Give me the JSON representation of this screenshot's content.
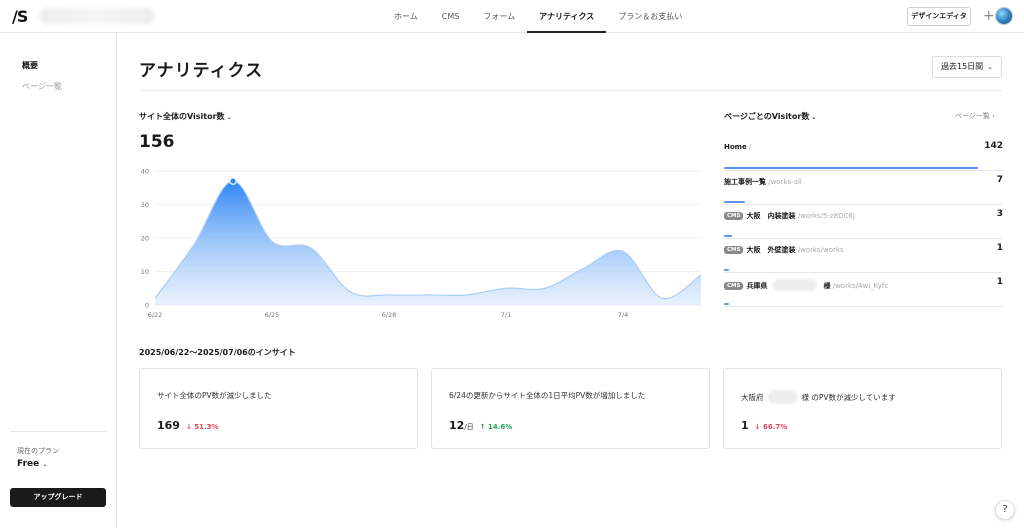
{
  "header": {
    "logo": "/S",
    "nav": [
      "ホーム",
      "CMS",
      "フォーム",
      "アナリティクス",
      "プラン＆お支払い"
    ],
    "active_nav": 3,
    "design_editor": "デザインエディタ",
    "plus": "+"
  },
  "sidebar": {
    "items": [
      "概要",
      "ページ一覧"
    ],
    "plan_label": "現在のプラン",
    "plan_value": "Free",
    "upgrade_label": "アップグレード"
  },
  "main": {
    "title": "アナリティクス",
    "period": "過去15日間"
  },
  "visitors": {
    "title": "サイト全体のVisitor数",
    "total": "156"
  },
  "chart_data": {
    "type": "area",
    "x": [
      "6/22",
      "6/23",
      "6/24",
      "6/25",
      "6/26",
      "6/27",
      "6/28",
      "6/29",
      "6/30",
      "7/1",
      "7/2",
      "7/3",
      "7/4",
      "7/5",
      "7/6"
    ],
    "series": [
      {
        "values": [
          2,
          18,
          37,
          19,
          17,
          4,
          3,
          3,
          3,
          5,
          5,
          11,
          16,
          2,
          9
        ]
      }
    ],
    "x_tick_labels": [
      "6/22",
      "6/25",
      "6/28",
      "7/1",
      "7/4"
    ],
    "y_ticks": [
      0,
      10,
      20,
      30,
      40
    ],
    "ylim": [
      0,
      40
    ],
    "grid": true,
    "highlight_index": 2,
    "color": "#2f86f5"
  },
  "page_visitors": {
    "title": "ページごとのVisitor数",
    "link": "ページ一覧",
    "rows": [
      {
        "name": "Home",
        "path": " /",
        "count": "142",
        "cms": false,
        "ratio": 1.0
      },
      {
        "name": "施工事例一覧",
        "path": " /works-all",
        "count": "7",
        "cms": false,
        "ratio": 0.05
      },
      {
        "name": "大阪　内装塗装",
        "path": " /works/5-z8DC6J",
        "count": "3",
        "cms": true,
        "ratio": 0.02
      },
      {
        "name": "大阪　外壁塗装",
        "path": " /works/works",
        "count": "1",
        "cms": true,
        "ratio": 0.008
      },
      {
        "name": "兵庫県",
        "name_suffix": "様",
        "path": " /works/4wi_Kyfc",
        "count": "1",
        "cms": true,
        "blur": true,
        "ratio": 0.008
      }
    ],
    "cms_badge": "CMS"
  },
  "insights": {
    "title": "2025/06/22〜2025/07/06のインサイト",
    "cards": [
      {
        "msg": "サイト全体のPV数が減少しました",
        "value": "169",
        "unit": "",
        "change": "↓ 51.3%",
        "dir": "down"
      },
      {
        "msg": "6/24の更新からサイト全体の1日平均PV数が増加しました",
        "value": "12",
        "unit": "/日",
        "change": "↑ 14.6%",
        "dir": "up"
      },
      {
        "msg_prefix": "大阪府",
        "msg_suffix": "様 のPV数が減少しています",
        "value": "1",
        "unit": "",
        "change": "↓ 66.7%",
        "dir": "down"
      }
    ]
  },
  "help": "?"
}
